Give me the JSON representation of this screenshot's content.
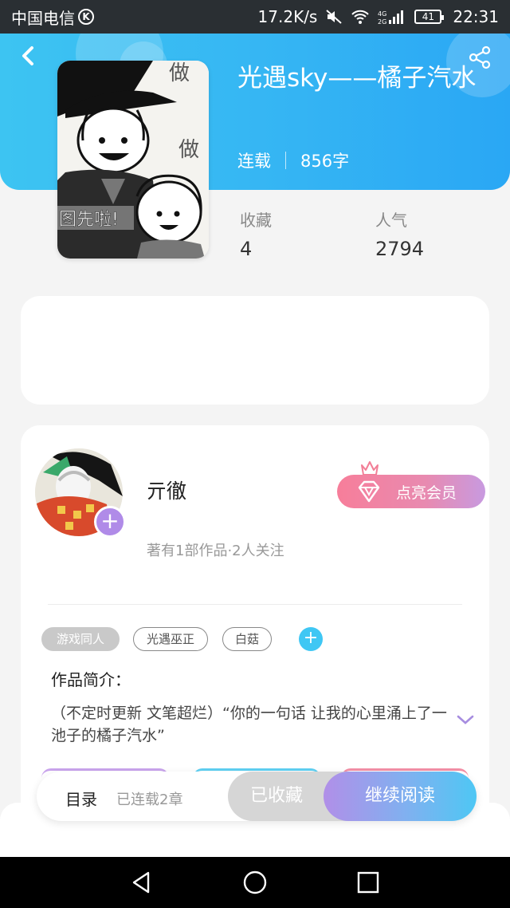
{
  "status_bar": {
    "carrier": "中国电信",
    "carrier_badge": "K",
    "net_speed": "17.2K/s",
    "battery": "41",
    "time": "22:31",
    "icons": [
      "mute-icon",
      "wifi-icon",
      "4g-signal-icon",
      "battery-icon"
    ]
  },
  "header": {
    "back_icon": "chevron-left-icon",
    "share_icon": "share-icon",
    "cover_text": [
      "做",
      "做",
      "图先啦!"
    ]
  },
  "book": {
    "title": "光遇sky——橘子汽水",
    "status": "连载",
    "word_count": "856字",
    "stats": [
      {
        "label": "收藏",
        "value": "4"
      },
      {
        "label": "人气",
        "value": "2794"
      }
    ]
  },
  "author": {
    "name": "亓徹",
    "summary": "著有1部作品·2人关注",
    "follow_icon": "plus-icon",
    "vip_button": "点亮会员",
    "vip_icon": "diamond-icon",
    "crown_icon": "crown-icon"
  },
  "tags": [
    "游戏同人",
    "光遇巫正",
    "白菇"
  ],
  "intro": {
    "label": "作品简介：",
    "text": "（不定时更新 文笔超烂）“你的一句话 让我的心里涌上了一池子的橘子汽水”",
    "expand_icon": "chevron-down-icon"
  },
  "action_bar": {
    "toc": "目录",
    "chapters": "已连载2章",
    "favorited": "已收藏",
    "continue": "继续阅读"
  },
  "nav_bar": {
    "icons": [
      "back-triangle-icon",
      "home-circle-icon",
      "recents-square-icon"
    ]
  },
  "colors": {
    "header_gradient": [
      "#3dc4f2",
      "#2aa7f4"
    ],
    "accent_blue": "#3fc7f4",
    "accent_purple": "#b08be8",
    "vip_pink": "#f77e9a"
  }
}
